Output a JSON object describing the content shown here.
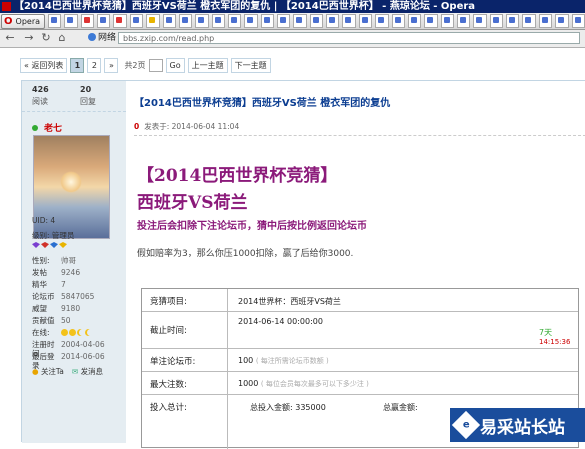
{
  "window": {
    "title": "【2014巴西世界杯竞猜】西班牙VS荷兰  橙衣军团的复仇 | 【2014巴西世界杯】 - 燕琼论坛 - Opera"
  },
  "browser": {
    "menu_label": "Opera",
    "address_label": "网络",
    "url": "bbs.zxip.com/read.php"
  },
  "pager": {
    "back": "« 返回列表",
    "pages": [
      "1",
      "2"
    ],
    "next": "»",
    "total": "共2页",
    "go": "Go",
    "prev_thread": "上一主题",
    "next_thread": "下一主题"
  },
  "sidebar": {
    "reads": "426",
    "reads_label": "阅读",
    "replies": "20",
    "replies_label": "回复",
    "username": "老七",
    "uid": "UID: 4",
    "level": "级别: 管理员",
    "profile": [
      {
        "k": "性别:",
        "v": "帅哥"
      },
      {
        "k": "发帖",
        "v": "9246"
      },
      {
        "k": "精华",
        "v": "7"
      },
      {
        "k": "论坛币",
        "v": "5847065"
      },
      {
        "k": "威望",
        "v": "9180"
      },
      {
        "k": "贡献值",
        "v": "50"
      },
      {
        "k": "在线:",
        "v": ""
      },
      {
        "k": "注册时间",
        "v": "2004-04-06"
      },
      {
        "k": "最后登录",
        "v": "2014-06-06"
      }
    ],
    "follow": "关注Ta",
    "message": "发消息"
  },
  "post": {
    "thread_title": "【2014巴西世界杯竞猜】西班牙VS荷兰   橙衣军团的复仇",
    "floor": "0",
    "posted": "发表于: 2014-06-04 11:04",
    "headline": "【2014巴西世界杯竞猜】",
    "matchup": "西班牙VS荷兰",
    "note": "投注后会扣除下注论坛币，猜中后按比例返回论坛币",
    "desc": "假如赔率为3，那么你压1000扣除，赢了后给你3000."
  },
  "bet_table": {
    "item_label": "竞猜项目:",
    "item_value": "2014世界杯：西班牙VS荷兰",
    "deadline_label": "截止时间:",
    "deadline_value": "2014-06-14 00:00:00",
    "countdown_days": "7天",
    "countdown_time": "14:15:36",
    "single_label": "单注论坛币:",
    "single_value": "100",
    "single_hint": "( 每注所需论坛币数额 )",
    "max_label": "最大注数:",
    "max_value": "1000",
    "max_hint": "( 每位会员每次最多可以下多少注 )",
    "total_label": "投入总计:",
    "total_bet_label": "总投入金额:",
    "total_bet_value": "335000",
    "total_amount_label": "总赢金额:"
  },
  "watermark": {
    "text": "易采站长站",
    "logo": "e"
  }
}
